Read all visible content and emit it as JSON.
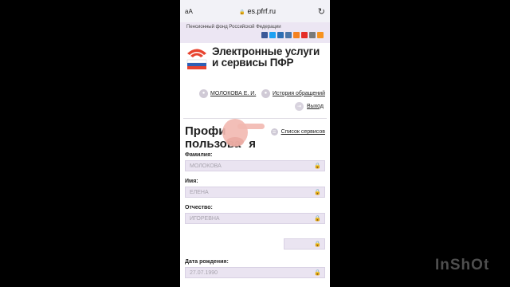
{
  "browser": {
    "aa_label": "aA",
    "url": "es.pfrf.ru",
    "reload_icon": "↻"
  },
  "site": {
    "org_name": "Пенсионный фонд Российской Федерации",
    "socials": [
      {
        "icon": "facebook-icon",
        "color": "#3b5998"
      },
      {
        "icon": "twitter-icon",
        "color": "#1da1f2"
      },
      {
        "icon": "mail-icon",
        "color": "#2d6fb4"
      },
      {
        "icon": "vk-icon",
        "color": "#4a76a8"
      },
      {
        "icon": "odnoklassniki-icon",
        "color": "#f58220"
      },
      {
        "icon": "youtube-icon",
        "color": "#e52d27"
      },
      {
        "icon": "rss-share-icon",
        "color": "#7a7a7a"
      },
      {
        "icon": "rss-icon",
        "color": "#f7931e"
      }
    ],
    "brand_line1": "Электронные услуги",
    "brand_line2": "и сервисы ПФР"
  },
  "user": {
    "name": "МОЛОКОВА Е. И.",
    "history_label": "История обращений",
    "exit_label": "Выход"
  },
  "profile": {
    "title_line1": "Профи",
    "title_line2": "пользова",
    "title_line3": "я",
    "services_label": "Список сервисов",
    "fields": [
      {
        "label": "Фамилия:",
        "value": "МОЛОКОВА"
      },
      {
        "label": "Имя:",
        "value": "ЕЛЕНА"
      },
      {
        "label": "Отчество:",
        "value": "ИГОРЕВНА"
      },
      {
        "label": "",
        "value": ""
      },
      {
        "label": "Дата рождения:",
        "value": "27.07.1990"
      }
    ]
  },
  "watermark": "InShOt",
  "colors": {
    "accent_field": "#eae4f1",
    "header_bar": "#ece6f3",
    "hand": "#f2b8b0"
  }
}
